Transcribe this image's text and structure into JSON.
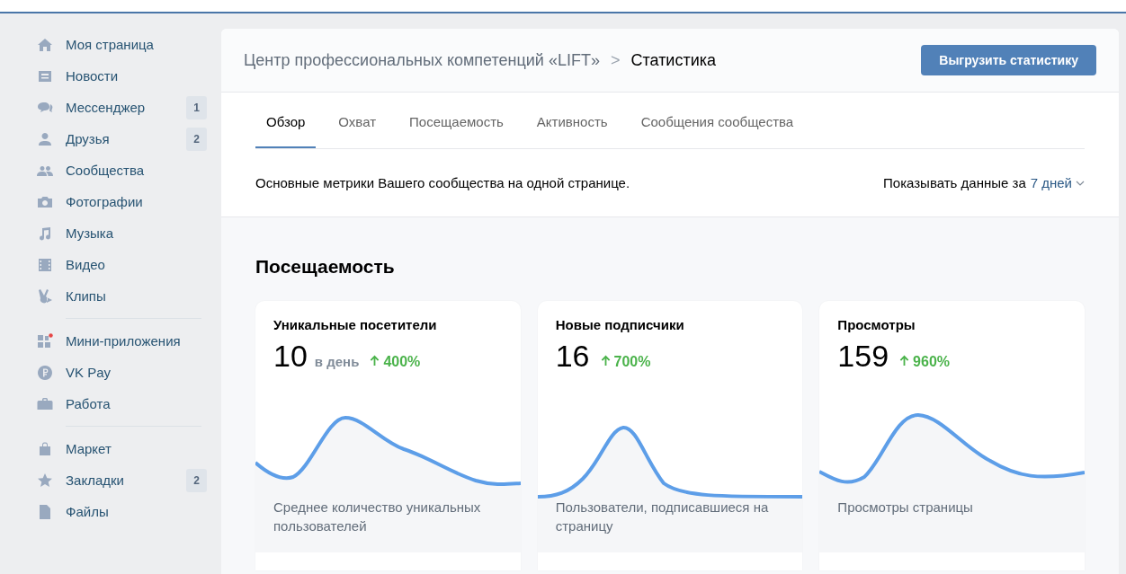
{
  "sidebar": {
    "groups": [
      {
        "items": [
          {
            "label": "Моя страница"
          },
          {
            "label": "Новости"
          },
          {
            "label": "Мессенджер",
            "counter": "1"
          },
          {
            "label": "Друзья",
            "counter": "2"
          },
          {
            "label": "Сообщества"
          },
          {
            "label": "Фотографии"
          },
          {
            "label": "Музыка"
          },
          {
            "label": "Видео"
          },
          {
            "label": "Клипы"
          }
        ]
      },
      {
        "items": [
          {
            "label": "Мини-приложения"
          },
          {
            "label": "VK Pay"
          },
          {
            "label": "Работа"
          }
        ]
      },
      {
        "items": [
          {
            "label": "Маркет"
          },
          {
            "label": "Закладки",
            "counter": "2"
          },
          {
            "label": "Файлы"
          }
        ]
      }
    ]
  },
  "header": {
    "breadcrumb": "Центр профессиональных компетенций «LIFT»",
    "separator": ">",
    "title": "Статистика",
    "button": "Выгрузить статистику"
  },
  "tabs": [
    {
      "label": "Обзор",
      "selected": true
    },
    {
      "label": "Охват",
      "selected": false
    },
    {
      "label": "Посещаемость",
      "selected": false
    },
    {
      "label": "Активность",
      "selected": false
    },
    {
      "label": "Сообщения сообщества",
      "selected": false
    }
  ],
  "summary": {
    "text": "Основные метрики Вашего сообщества на одной странице.",
    "period_label": "Показывать данные за",
    "period_value": "7 дней"
  },
  "section": {
    "title": "Посещаемость",
    "cards": [
      {
        "title": "Уникальные посетители",
        "value": "10",
        "unit": "в день",
        "change": "400%",
        "footer": "Среднее количество уникальных пользователей"
      },
      {
        "title": "Новые подписчики",
        "value": "16",
        "change": "700%",
        "footer": "Пользователи, подписавшиеся на страницу"
      },
      {
        "title": "Просмотры",
        "value": "159",
        "change": "960%",
        "footer": "Просмотры страницы"
      }
    ]
  }
}
